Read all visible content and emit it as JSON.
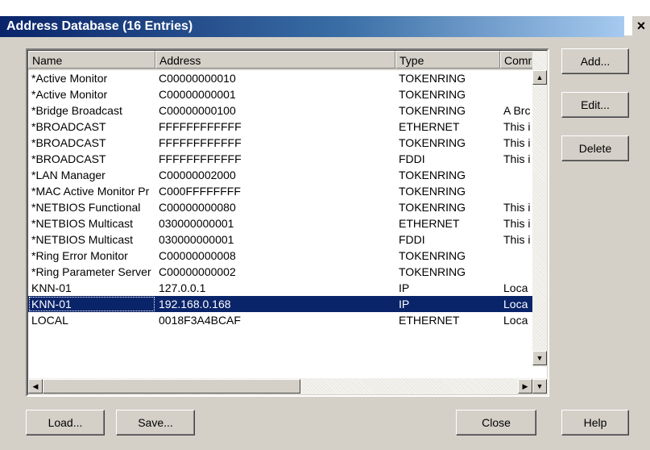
{
  "window": {
    "title": "Address Database (16 Entries)",
    "close_glyph": "×"
  },
  "table": {
    "columns": [
      "Name",
      "Address",
      "Type",
      "Comr"
    ],
    "rows": [
      {
        "name": "*Active Monitor",
        "address": "C00000000010",
        "type": "TOKENRING",
        "comment": ""
      },
      {
        "name": "*Active Monitor",
        "address": "C00000000001",
        "type": "TOKENRING",
        "comment": ""
      },
      {
        "name": "*Bridge Broadcast",
        "address": "C00000000100",
        "type": "TOKENRING",
        "comment": "A Brc"
      },
      {
        "name": "*BROADCAST",
        "address": "FFFFFFFFFFFF",
        "type": "ETHERNET",
        "comment": "This i"
      },
      {
        "name": "*BROADCAST",
        "address": "FFFFFFFFFFFF",
        "type": "TOKENRING",
        "comment": "This i"
      },
      {
        "name": "*BROADCAST",
        "address": "FFFFFFFFFFFF",
        "type": "FDDI",
        "comment": "This i"
      },
      {
        "name": "*LAN Manager",
        "address": "C00000002000",
        "type": "TOKENRING",
        "comment": ""
      },
      {
        "name": "*MAC Active Monitor Pr",
        "address": "C000FFFFFFFF",
        "type": "TOKENRING",
        "comment": ""
      },
      {
        "name": "*NETBIOS Functional",
        "address": "C00000000080",
        "type": "TOKENRING",
        "comment": "This i"
      },
      {
        "name": "*NETBIOS Multicast",
        "address": "030000000001",
        "type": "ETHERNET",
        "comment": "This i"
      },
      {
        "name": "*NETBIOS Multicast",
        "address": "030000000001",
        "type": "FDDI",
        "comment": "This i"
      },
      {
        "name": "*Ring Error Monitor",
        "address": "C00000000008",
        "type": "TOKENRING",
        "comment": ""
      },
      {
        "name": "*Ring Parameter Server",
        "address": "C00000000002",
        "type": "TOKENRING",
        "comment": ""
      },
      {
        "name": "KNN-01",
        "address": "127.0.0.1",
        "type": "IP",
        "comment": "Loca"
      },
      {
        "name": "KNN-01",
        "address": "192.168.0.168",
        "type": "IP",
        "comment": "Loca",
        "selected": true
      },
      {
        "name": "LOCAL",
        "address": "0018F3A4BCAF",
        "type": "ETHERNET",
        "comment": "Loca"
      }
    ]
  },
  "buttons": {
    "add": "Add...",
    "edit": "Edit...",
    "delete": "Delete",
    "load": "Load...",
    "save": "Save...",
    "close": "Close",
    "help": "Help"
  },
  "scroll_glyphs": {
    "up": "▲",
    "down": "▼",
    "left": "◀",
    "right": "▶"
  }
}
